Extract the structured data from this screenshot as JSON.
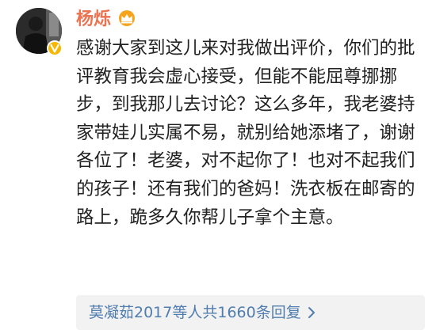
{
  "post": {
    "user": {
      "name": "杨烁",
      "avatar_icon": "user-avatar",
      "badge_icon": "verified-v-badge-icon",
      "vip_icon": "crown-icon",
      "name_color": "#eb7350"
    },
    "comment_text": "感谢大家到这儿来对我做出评价，你们的批评教育我会虚心接受，但能不能屈尊挪挪步，到我那儿去讨论？这么多年，我老婆持家带娃儿实属不易，就别给她添堵了，谢谢各位了！老婆，对不起你了！也对不起我们的孩子！还有我们的爸妈！洗衣板在邮寄的路上，跪多久你帮儿子拿个主意。",
    "replies": {
      "users": "莫凝茹2017等人",
      "count_text": "共1660条回复",
      "chevron_icon": "chevron-right-icon",
      "link_color": "#507daf"
    }
  }
}
